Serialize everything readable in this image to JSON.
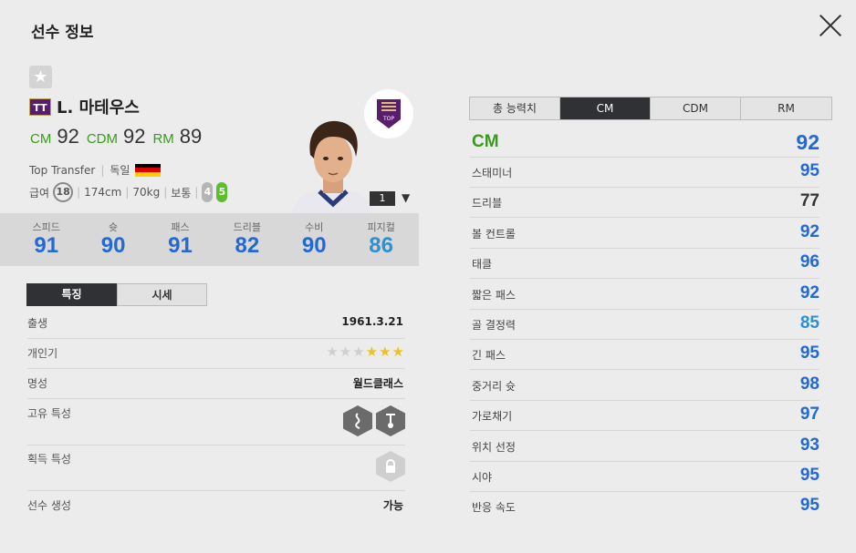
{
  "header": {
    "title": "선수 정보"
  },
  "player": {
    "season_badge": "TT",
    "name": "L. 마테우스",
    "positions": [
      {
        "pos": "CM",
        "ovr": "92"
      },
      {
        "pos": "CDM",
        "ovr": "92"
      },
      {
        "pos": "RM",
        "ovr": "89"
      }
    ],
    "season_name": "Top Transfer",
    "nationality": "독일",
    "pay_label": "급여",
    "pay": "18",
    "height": "174cm",
    "weight": "70kg",
    "body_type": "보통",
    "weak_foot_left": "4",
    "weak_foot_right": "5",
    "enhance_level": "1",
    "club_badge_text": "TOP"
  },
  "summary_stats": [
    {
      "label": "스피드",
      "value": "91"
    },
    {
      "label": "슛",
      "value": "90"
    },
    {
      "label": "패스",
      "value": "91"
    },
    {
      "label": "드리블",
      "value": "82"
    },
    {
      "label": "수비",
      "value": "90"
    },
    {
      "label": "피지컬",
      "value": "86"
    }
  ],
  "info_tabs": [
    "특징",
    "시세"
  ],
  "info": {
    "birth_label": "출생",
    "birth": "1961.3.21",
    "popularity_label": "개인기",
    "skill_stars": 3,
    "skill_stars_max": 6,
    "fame_label": "명성",
    "fame": "월드클래스",
    "unique_trait_label": "고유 특성",
    "acquired_trait_label": "획득 특성",
    "create_label": "선수 생성",
    "create": "가능"
  },
  "ability_tabs": [
    "총 능력치",
    "CM",
    "CDM",
    "RM"
  ],
  "ability": {
    "position": "CM",
    "ovr": "92",
    "stats": [
      {
        "label": "스태미너",
        "value": "95",
        "color": "#2468d2"
      },
      {
        "label": "드리블",
        "value": "77",
        "color": "#333333"
      },
      {
        "label": "볼 컨트롤",
        "value": "92",
        "color": "#2468d2"
      },
      {
        "label": "태클",
        "value": "96",
        "color": "#2468d2"
      },
      {
        "label": "짧은 패스",
        "value": "92",
        "color": "#2468d2"
      },
      {
        "label": "골 결정력",
        "value": "85",
        "color": "#2e8fd4"
      },
      {
        "label": "긴 패스",
        "value": "95",
        "color": "#2468d2"
      },
      {
        "label": "중거리 슛",
        "value": "98",
        "color": "#2468d2"
      },
      {
        "label": "가로채기",
        "value": "97",
        "color": "#2468d2"
      },
      {
        "label": "위치 선정",
        "value": "93",
        "color": "#2468d2"
      },
      {
        "label": "시야",
        "value": "95",
        "color": "#2468d2"
      },
      {
        "label": "반응 속도",
        "value": "95",
        "color": "#2468d2"
      }
    ]
  },
  "colors": {
    "accent_green": "#3a9a1e",
    "stat_blue": "#2468d2",
    "dark_tab": "#2f3135"
  }
}
